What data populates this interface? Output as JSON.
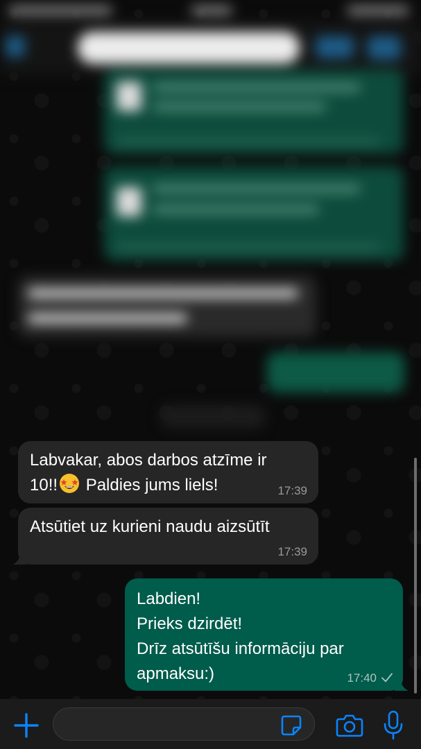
{
  "messages": [
    {
      "direction": "incoming",
      "text_before_emoji": "Labvakar, abos darbos atzīme ir\n10!!",
      "emoji": "star-struck-emoji",
      "text_after_emoji": " Paldies jums liels!",
      "time": "17:39"
    },
    {
      "direction": "incoming",
      "text": "Atsūtiet uz kurieni naudu aizsūtīt",
      "time": "17:39"
    },
    {
      "direction": "outgoing",
      "text": "Labdien!\nPrieks dzirdēt!\nDrīz atsūtīšu informāciju par\napmaksu:)",
      "time": "17:40",
      "status_icon": "single-check-icon"
    }
  ],
  "input_bar": {
    "message_value": "",
    "icons": [
      "plus-icon",
      "sticker-icon",
      "camera-icon",
      "microphone-icon"
    ]
  },
  "colors": {
    "accent": "#0a84ff",
    "incoming_bubble": "#262626",
    "outgoing_bubble": "#005c4b",
    "background": "#0b0b0b"
  }
}
